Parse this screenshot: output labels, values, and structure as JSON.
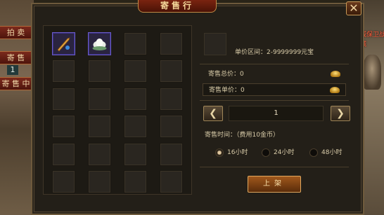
{
  "window": {
    "title": "寄售行",
    "close_glyph": "✕"
  },
  "side_tabs": [
    {
      "label": "拍 卖"
    },
    {
      "label": "寄 售"
    },
    {
      "label": "寄 售 中"
    }
  ],
  "side_badge": "1",
  "right_overlay": {
    "line1": "威保卫战",
    "line2": "城"
  },
  "grid": {
    "rows": 6,
    "cols": 4,
    "filled_items": [
      "sword-item-icon",
      "lotus-item-icon"
    ]
  },
  "preview": {
    "price_range": "单价区间：2-9999999元宝"
  },
  "fields": {
    "total_price": "寄售总价：0",
    "unit_price": "寄售单价：0"
  },
  "quantity": {
    "value": "1",
    "prev_glyph": "❮",
    "next_glyph": "❯"
  },
  "duration": {
    "label": "寄售时间：（费用10金币）",
    "options": [
      {
        "label": "16小时",
        "selected": true
      },
      {
        "label": "24小时",
        "selected": false
      },
      {
        "label": "48小时",
        "selected": false
      }
    ]
  },
  "submit_label": "上架",
  "colors": {
    "accent": "#a0581c",
    "panel": "#231f18",
    "frame": "#6e5a3c"
  }
}
